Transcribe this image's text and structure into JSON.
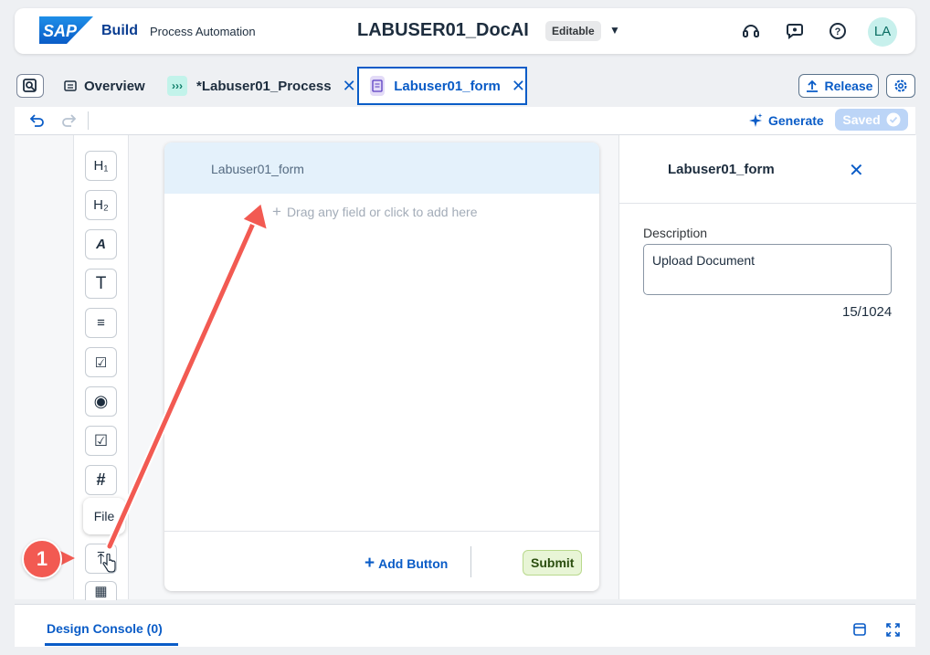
{
  "shell": {
    "logo_text": "SAP",
    "brand": "Build",
    "subtitle": "Process Automation",
    "project_title": "LABUSER01_DocAI",
    "mode_badge": "Editable",
    "avatar_initials": "LA"
  },
  "tabs": [
    {
      "label": "Overview",
      "icon": "overview-icon",
      "active": false
    },
    {
      "label": "*Labuser01_Process",
      "icon": "process-icon",
      "active": false
    },
    {
      "label": "Labuser01_form",
      "icon": "form-icon",
      "active": true
    }
  ],
  "header_actions": {
    "release_label": "Release"
  },
  "toolbar": {
    "generate_label": "Generate",
    "saved_label": "Saved"
  },
  "palette": {
    "items": [
      {
        "icon": "heading1-icon",
        "glyph": "H₁"
      },
      {
        "icon": "heading2-icon",
        "glyph": "H₂"
      },
      {
        "icon": "text-style-icon",
        "glyph": "A"
      },
      {
        "icon": "text-icon",
        "glyph": "T"
      },
      {
        "icon": "paragraph-icon",
        "glyph": "≡"
      },
      {
        "icon": "checklist-icon",
        "glyph": "☑"
      },
      {
        "icon": "radio-icon",
        "glyph": "◉"
      },
      {
        "icon": "checkbox-icon",
        "glyph": "☑"
      },
      {
        "icon": "number-icon",
        "glyph": "#"
      },
      {
        "icon": "file-upload-icon",
        "glyph": "⤒"
      },
      {
        "icon": "table-icon",
        "glyph": "▦"
      }
    ],
    "tooltip": "File"
  },
  "form": {
    "title": "Labuser01_form",
    "drop_hint": "Drag any field or click to add here",
    "add_button_label": "Add Button",
    "submit_label": "Submit"
  },
  "side_panel": {
    "title": "Labuser01_form",
    "description_label": "Description",
    "description_value": "Upload Document",
    "char_count": "15/1024"
  },
  "annotation": {
    "step": "1"
  },
  "console": {
    "label": "Design Console (0)"
  },
  "colors": {
    "accent": "#0a5cc7",
    "annotation": "#f25a52",
    "sap_blue": "#0a6ed1"
  }
}
